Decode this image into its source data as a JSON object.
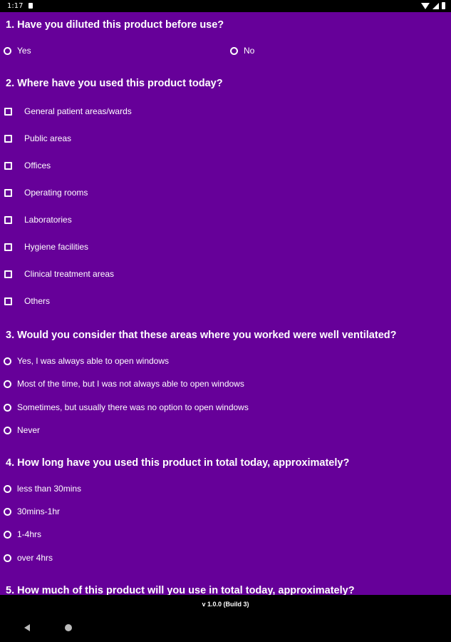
{
  "status_bar": {
    "time": "1:17"
  },
  "questions": [
    {
      "title": "1. Have you diluted this product before use?",
      "type": "radio",
      "options": [
        "Yes",
        "No"
      ]
    },
    {
      "title": "2. Where have you used this product today?",
      "type": "checkbox",
      "options": [
        "General patient areas/wards",
        "Public areas",
        "Offices",
        "Operating rooms",
        "Laboratories",
        "Hygiene facilities",
        "Clinical treatment areas",
        "Others"
      ]
    },
    {
      "title": "3. Would you consider that these areas where you worked were well ventilated?",
      "type": "radio",
      "options": [
        "Yes, I was always able to open windows",
        "Most of the time, but I was not always able to open windows",
        "Sometimes, but usually there was no option to open windows",
        "Never"
      ]
    },
    {
      "title": "4. How long have you used this product in total today, approximately?",
      "type": "radio",
      "options": [
        "less than 30mins",
        "30mins-1hr",
        "1-4hrs",
        "over 4hrs"
      ]
    },
    {
      "title": "5. How much of this product will you use in total today, approximately?"
    }
  ],
  "footer": {
    "version": "v 1.0.0 (Build 3)"
  },
  "colors": {
    "background": "#660099",
    "text": "#ffffff"
  },
  "icons": [
    "sd-card-icon",
    "wifi-icon",
    "signal-icon",
    "battery-icon",
    "back-icon",
    "home-icon"
  ]
}
